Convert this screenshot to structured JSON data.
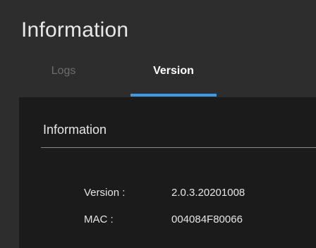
{
  "page": {
    "title": "Information"
  },
  "tabs": [
    {
      "label": "Logs",
      "active": false
    },
    {
      "label": "Version",
      "active": true
    }
  ],
  "colors": {
    "accent": "#3d9be6",
    "background": "#2d2d2d",
    "panel": "#1b1b1b"
  },
  "panel": {
    "title": "Information",
    "rows": [
      {
        "label": "Version :",
        "value": "2.0.3.20201008"
      },
      {
        "label": "MAC :",
        "value": "004084F80066"
      }
    ]
  }
}
